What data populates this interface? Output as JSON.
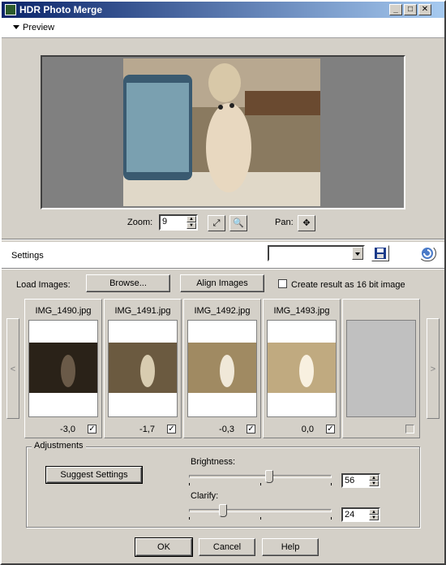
{
  "window": {
    "title": "HDR Photo Merge",
    "min": "_",
    "max": "□",
    "close": "✕"
  },
  "preview": {
    "label": "Preview"
  },
  "zoom": {
    "label": "Zoom:",
    "value": "9"
  },
  "pan": {
    "label": "Pan:",
    "icon": "✥"
  },
  "settings": {
    "label": "Settings",
    "preset": ""
  },
  "load": {
    "label": "Load Images:",
    "browse": "Browse...",
    "align": "Align Images",
    "create16": "Create result as 16 bit image"
  },
  "images": [
    {
      "name": "IMG_1490.jpg",
      "ev": "-3,0",
      "checked": "✓",
      "tone": "#2a2218"
    },
    {
      "name": "IMG_1491.jpg",
      "ev": "-1,7",
      "checked": "✓",
      "tone": "#6b5a40"
    },
    {
      "name": "IMG_1492.jpg",
      "ev": "-0,3",
      "checked": "✓",
      "tone": "#a08a62"
    },
    {
      "name": "IMG_1493.jpg",
      "ev": "0,0",
      "checked": "✓",
      "tone": "#c0aa80"
    }
  ],
  "nav": {
    "prev": "<",
    "next": ">"
  },
  "adjustments": {
    "title": "Adjustments",
    "suggest": "Suggest Settings",
    "brightness_label": "Brightness:",
    "brightness": "56",
    "brightness_level": 0.56,
    "clarify_label": "Clarify:",
    "clarify": "24",
    "clarify_level": 0.24
  },
  "buttons": {
    "ok": "OK",
    "cancel": "Cancel",
    "help": "Help"
  }
}
